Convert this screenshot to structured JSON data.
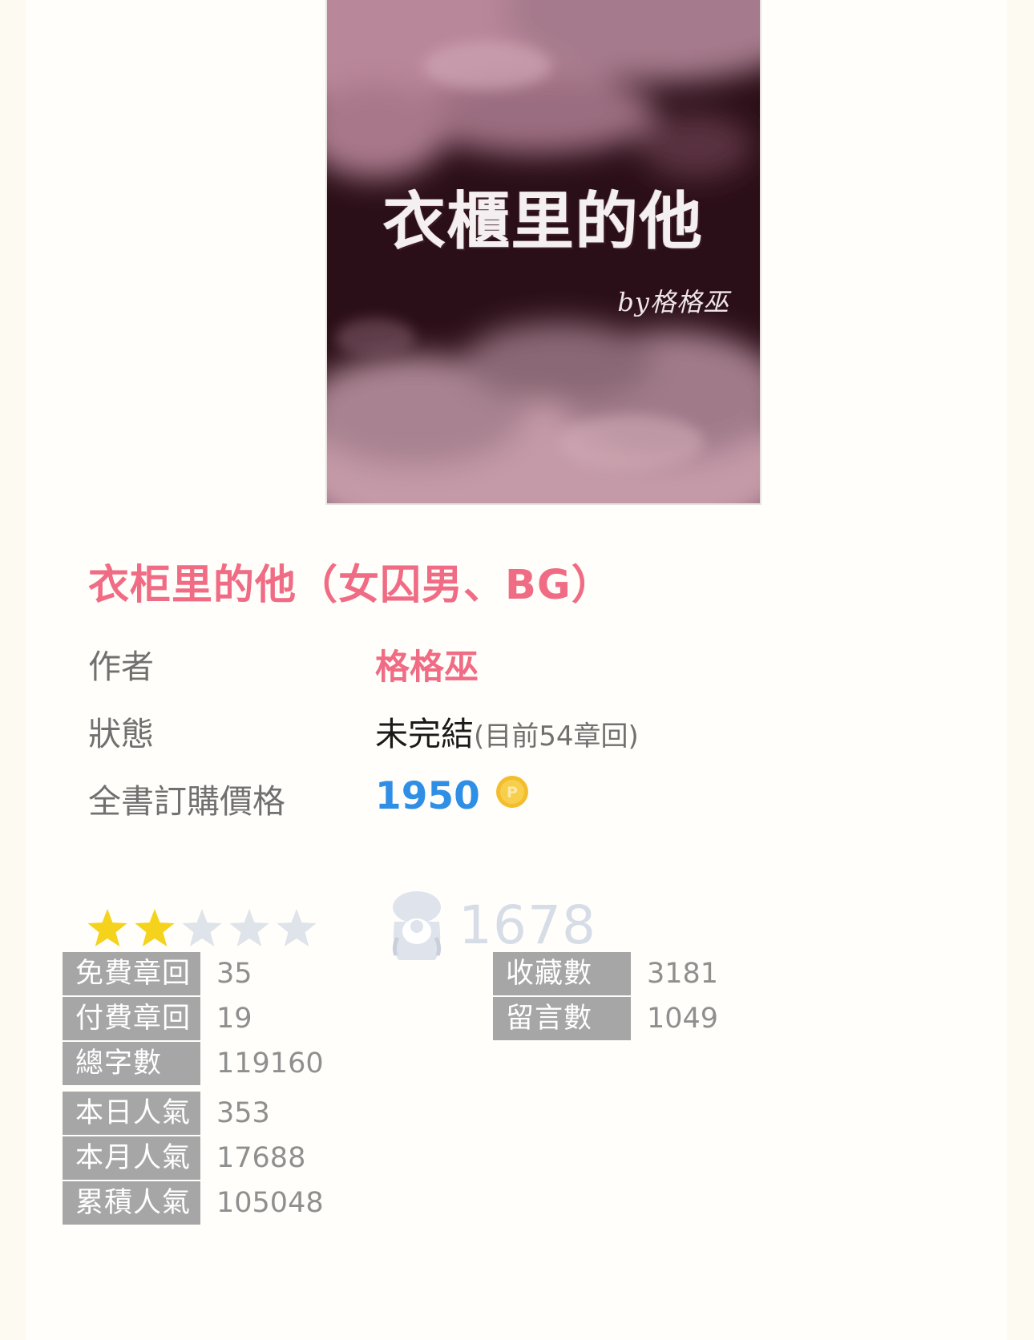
{
  "cover": {
    "title": "衣櫃里的他",
    "byline": "by格格巫"
  },
  "book": {
    "title": "衣柜里的他（女囚男、BG）"
  },
  "info": {
    "author_label": "作者",
    "author_name": "格格巫",
    "status_label": "狀態",
    "status_value": "未完結",
    "status_detail": "(目前54章回)",
    "price_label": "全書訂購價格",
    "price_value": "1950",
    "currency_icon": "p-coin-icon"
  },
  "rating": {
    "stars_filled": 2,
    "stars_total": 5,
    "favorites_icon": "favorite-bag-icon",
    "favorites_count": "1678"
  },
  "stats": {
    "left": [
      {
        "label": "免費章回",
        "value": "35"
      },
      {
        "label": "付費章回",
        "value": "19"
      },
      {
        "label": "總字數",
        "value": "119160"
      },
      {
        "label": "本日人氣",
        "value": "353"
      },
      {
        "label": "本月人氣",
        "value": "17688"
      },
      {
        "label": "累積人氣",
        "value": "105048"
      }
    ],
    "right": [
      {
        "label": "收藏數",
        "value": "3181"
      },
      {
        "label": "留言數",
        "value": "1049"
      }
    ]
  },
  "colors": {
    "accent_pink": "#f06c84",
    "price_blue": "#2f8ee6",
    "star_gold": "#f5d31c",
    "star_empty": "#dfe3ea",
    "label_bg": "#a6a6a6"
  }
}
